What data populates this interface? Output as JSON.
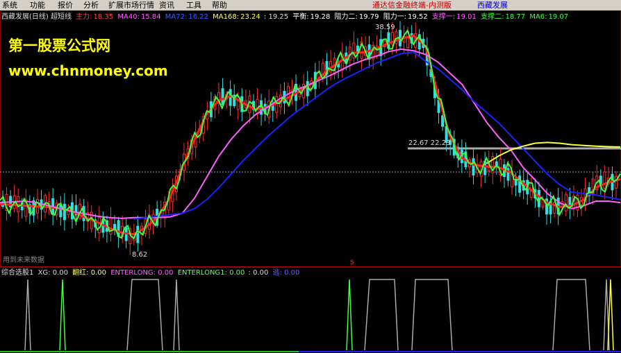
{
  "menu": {
    "items": [
      "系统",
      "功能",
      "报价",
      "分析",
      "扩展市场行情",
      "资讯",
      "工具",
      "帮助"
    ],
    "client_link": "通达信金融终端-内测版",
    "stock_title": "西藏发展"
  },
  "main_panel": {
    "title": "西藏发展(日线) 超短线",
    "indicators": {
      "zhuli_label": "主力:",
      "zhuli_value": "18.35",
      "ma40_label": "MA40:",
      "ma40_value": "15.84",
      "ma72_label": "MA72:",
      "ma72_value": "16.22",
      "ma168_label": "MA168:",
      "ma168_value": "23.24",
      "extra_value": ": 19.25",
      "pingheng_label": "平衡:",
      "pingheng_value": "19.28",
      "zuli2_label": "阻力二:",
      "zuli2_value": "19.79",
      "zuli1_label": "阻力一:",
      "zuli1_value": "19.52",
      "zhicheng1_label": "支撑一:",
      "zhicheng1_value": "19.01",
      "zhicheng2_label": "支撑二:",
      "zhicheng2_value": "18.77",
      "ma6_label": "MA6:",
      "ma6_value": "19.07"
    },
    "watermark_line1": "第一股票公式网",
    "watermark_line2": "www.chnmoney.com",
    "annotations": {
      "high_label": "38.59",
      "low_label": "8.62",
      "mid_label": "22.67  22.23",
      "future_data_text": "用到未来数据",
      "s_marker": "S"
    }
  },
  "sub_panel": {
    "title": "综合选股1",
    "xg": "XG: 0.00",
    "fanhong": "翻红: 0.00",
    "enterlong": "ENTERLONG: 0.00",
    "enterlong1": "ENTERLONG1: 0.00",
    "extra": ": 0.00",
    "tao": "逃: 0.00"
  },
  "colors": {
    "red": "#ff2020",
    "green": "#3cff3c",
    "magenta": "#ff60ff",
    "blue": "#2020ff",
    "yellow": "#ffff40",
    "gray_line": "#b0b0b0"
  },
  "chart_data": {
    "type": "line",
    "series": [
      {
        "name": "主力",
        "values": [
          15.6,
          15.5,
          15.4,
          15.3,
          15.2,
          15.0,
          14.6,
          13.8,
          13.2,
          12.4,
          11.8,
          11.6,
          12.5,
          14.0,
          16.5,
          20.5,
          24.2,
          27.6,
          29.4,
          30.0,
          29.0,
          28.2,
          28.5,
          29.2,
          30.0,
          31.0,
          32.0,
          33.5,
          34.6,
          35.7,
          35.8,
          36.3,
          37.0,
          37.6,
          38.0,
          36.6,
          30.2,
          24.6,
          21.7,
          20.8,
          20.6,
          20.5,
          19.8,
          18.4,
          17.0,
          15.8,
          15.2,
          15.4,
          16.2,
          17.8,
          18.5,
          18.9
        ]
      },
      {
        "name": "MA40",
        "values": [
          15.8,
          15.9,
          16.0,
          15.8,
          15.4,
          15.0,
          14.6,
          14.3,
          14.0,
          13.8,
          13.7,
          13.8,
          13.8,
          13.8,
          13.9,
          14.4,
          16.4,
          19.2,
          22.0,
          24.2,
          26.0,
          27.5,
          28.5,
          29.6,
          30.5,
          31.2,
          31.9,
          32.6,
          33.4,
          34.2,
          34.8,
          35.3,
          35.9,
          36.2,
          36.0,
          35.5,
          34.5,
          33.0,
          31.5,
          29.0,
          26.5,
          24.5,
          22.8,
          20.5,
          18.8,
          17.0,
          15.8,
          15.0,
          15.4,
          16.0,
          16.0,
          15.8
        ]
      },
      {
        "name": "MA72",
        "values": [
          null,
          null,
          null,
          null,
          null,
          null,
          null,
          null,
          null,
          null,
          null,
          13.6,
          13.8,
          14.0,
          14.2,
          14.4,
          15.0,
          16.2,
          17.8,
          19.6,
          21.4,
          23.0,
          24.6,
          26.0,
          27.4,
          28.6,
          29.8,
          31.0,
          32.0,
          32.8,
          33.6,
          34.4,
          35.0,
          35.6,
          35.8,
          34.6,
          33.6,
          32.2,
          30.8,
          29.2,
          27.8,
          26.4,
          24.7,
          23.0,
          21.3,
          19.6,
          18.2,
          17.2,
          17.0,
          16.8,
          16.5,
          16.2
        ]
      },
      {
        "name": "MA168",
        "values": [
          null,
          null,
          null,
          null,
          null,
          null,
          null,
          null,
          null,
          null,
          null,
          null,
          null,
          null,
          null,
          null,
          null,
          null,
          null,
          null,
          null,
          null,
          null,
          null,
          null,
          null,
          null,
          null,
          null,
          null,
          null,
          null,
          null,
          null,
          null,
          null,
          null,
          null,
          null,
          null,
          21.0,
          22.0,
          22.8,
          23.3,
          23.7,
          23.8,
          23.7,
          23.5,
          23.4,
          23.3,
          23.24,
          23.2
        ]
      }
    ],
    "y_range": [
      8.62,
      38.59
    ]
  }
}
